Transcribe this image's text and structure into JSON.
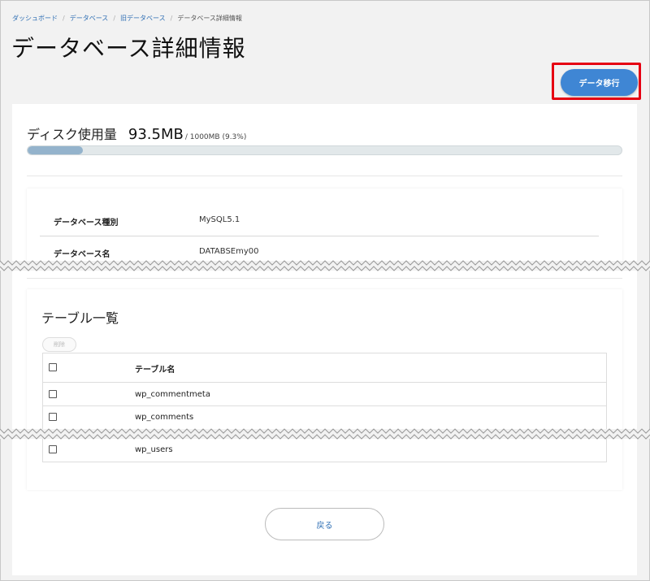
{
  "breadcrumb": {
    "items": [
      "ダッシュボード",
      "データベース",
      "旧データベース"
    ],
    "current": "データベース詳細情報"
  },
  "page": {
    "title": "データベース詳細情報"
  },
  "actions": {
    "migrate_label": "データ移行",
    "back_label": "戻る"
  },
  "disk": {
    "label": "ディスク使用量",
    "used": "93.5MB",
    "total": "/ 1000MB (9.3%)",
    "usage_fraction": 0.093
  },
  "info": {
    "rows": [
      {
        "label": "データベース種別",
        "value": "MySQL5.1"
      },
      {
        "label": "データベース名",
        "value": "DATABSEmy00"
      }
    ]
  },
  "tables": {
    "title": "テーブル一覧",
    "delete_label": "削除",
    "column_header": "テーブル名",
    "rows": [
      "wp_commentmeta",
      "wp_comments",
      "wp_users"
    ]
  },
  "colors": {
    "accent": "#3f86d4",
    "highlight": "#e60012",
    "progress_fill": "#94b3cc"
  }
}
